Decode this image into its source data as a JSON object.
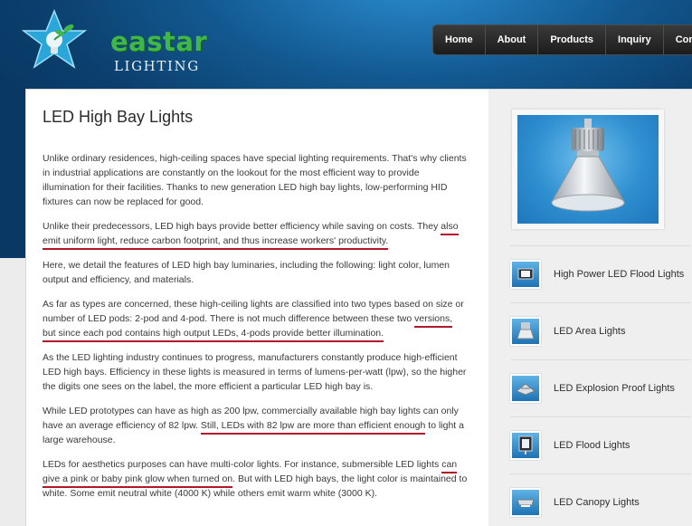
{
  "brand": {
    "name": "eastar",
    "tagline": "LIGHTING"
  },
  "nav": {
    "items": [
      {
        "label": "Home"
      },
      {
        "label": "About"
      },
      {
        "label": "Products"
      },
      {
        "label": "Inquiry"
      },
      {
        "label": "Contac"
      }
    ]
  },
  "page": {
    "title": "LED High Bay Lights"
  },
  "article": {
    "p1": "Unlike ordinary residences, high-ceiling spaces have special lighting requirements. That's why clients in industrial applications are constantly on the lookout for the most efficient way to provide illumination for their facilities. Thanks to new generation LED high bay lights, low-performing HID fixtures can now be replaced for good.",
    "p2a": "Unlike their predecessors, LED high bays provide better efficiency while saving on costs. They ",
    "p2b": "also emit uniform light, reduce carbon footprint, and thus increase workers' productivity.",
    "p3": "Here, we detail the features of LED high bay luminaries, including the following: light color, lumen output and efficiency, and materials.",
    "p4a": "As far as types are concerned, these high-ceiling lights are classified into two types based on size or number of LED pods: 2-pod and 4-pod. There is not much difference between these two ",
    "p4b": "versions, but since each pod contains high output LEDs, 4-pods provide better illumination.",
    "p5": "As the LED lighting industry continues to progress, manufacturers constantly produce high-efficient LED high bays. Efficiency in these lights is measured in terms of lumens-per-watt (lpw), so the higher the digits one sees on the label, the more efficient a particular LED high bay is.",
    "p6a": "While LED prototypes can have as high as 200 lpw, commercially available high bay lights can only have an average efficiency of 82 lpw. ",
    "p6b": "Still, LEDs with 82 lpw are more than efficient enough",
    "p6c": " to light a large warehouse.",
    "p7a": "LEDs for aesthetics purposes can have multi-color lights. For instance, submersible LED lights ",
    "p7b": "can give a pink or baby pink glow when turned on",
    "p7c": ". But with LED high bays, the light color is maintained to white. Some emit neutral white (4000 K) while others emit warm white (3000 K)."
  },
  "sidebar": {
    "items": [
      {
        "label": "High Power LED Flood Lights"
      },
      {
        "label": "LED Area Lights"
      },
      {
        "label": "LED Explosion Proof Lights"
      },
      {
        "label": "LED Flood Lights"
      },
      {
        "label": "LED Canopy Lights"
      }
    ]
  },
  "colors": {
    "header_blue": "#135a92",
    "logo_green": "#3fb849",
    "underline_red": "#b0192a",
    "nav_dark": "#1c1c1c"
  }
}
